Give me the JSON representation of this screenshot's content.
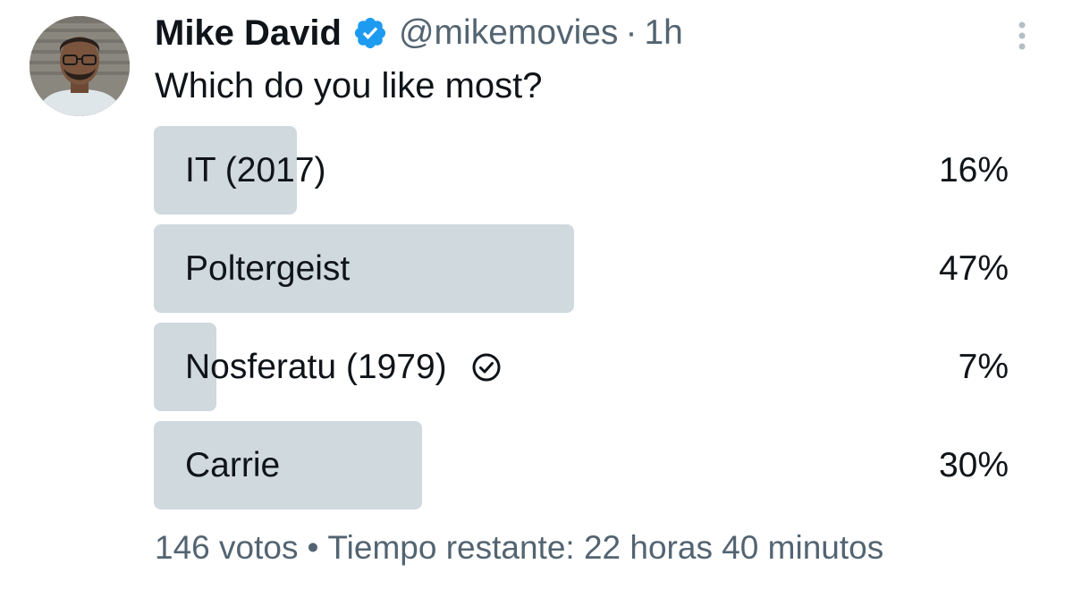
{
  "tweet": {
    "avatar_icon": "user-avatar-photo",
    "display_name": "Mike David",
    "verified_icon": "verified-badge-icon",
    "verified_color": "#1d9bf0",
    "handle": "@mikemovies",
    "separator": "·",
    "time": "1h",
    "more_icon": "more-vertical-icon",
    "question": "Which do you like most?"
  },
  "poll": {
    "bar_color": "#cfd9de",
    "options": [
      {
        "label": "IT (2017)",
        "percent_text": "16%",
        "percent": 16,
        "selected": false
      },
      {
        "label": "Poltergeist",
        "percent_text": "47%",
        "percent": 47,
        "selected": false
      },
      {
        "label": "Nosferatu (1979)",
        "percent_text": "7%",
        "percent": 7,
        "selected": true,
        "selected_icon": "check-circle-icon"
      },
      {
        "label": "Carrie",
        "percent_text": "30%",
        "percent": 30,
        "selected": false
      }
    ],
    "votes": "146 votos",
    "footer_separator": "•",
    "time_left": "Tiempo restante: 22 horas 40 minutos"
  }
}
